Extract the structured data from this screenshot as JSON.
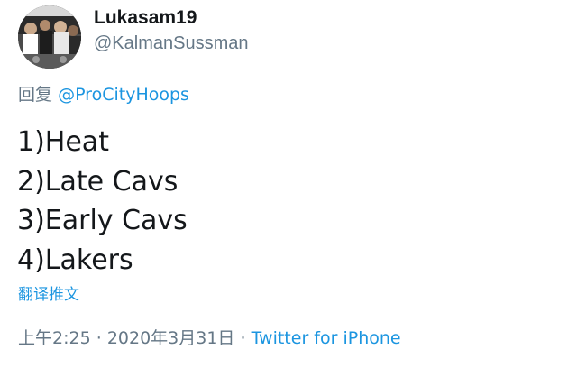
{
  "author": {
    "display_name": "Lukasam19",
    "handle": "@KalmanSussman"
  },
  "reply": {
    "prefix": "回复",
    "target": "@ProCityHoops"
  },
  "tweet": {
    "lines": [
      "1)Heat",
      "2)Late Cavs",
      "3)Early Cavs",
      "4)Lakers"
    ]
  },
  "translate_label": "翻译推文",
  "meta": {
    "time": "上午2:25",
    "separator": "·",
    "date": "2020年3月31日",
    "source": "Twitter for iPhone"
  },
  "colors": {
    "link": "#1b95e0",
    "secondary_text": "#657786",
    "primary_text": "#14171a"
  }
}
